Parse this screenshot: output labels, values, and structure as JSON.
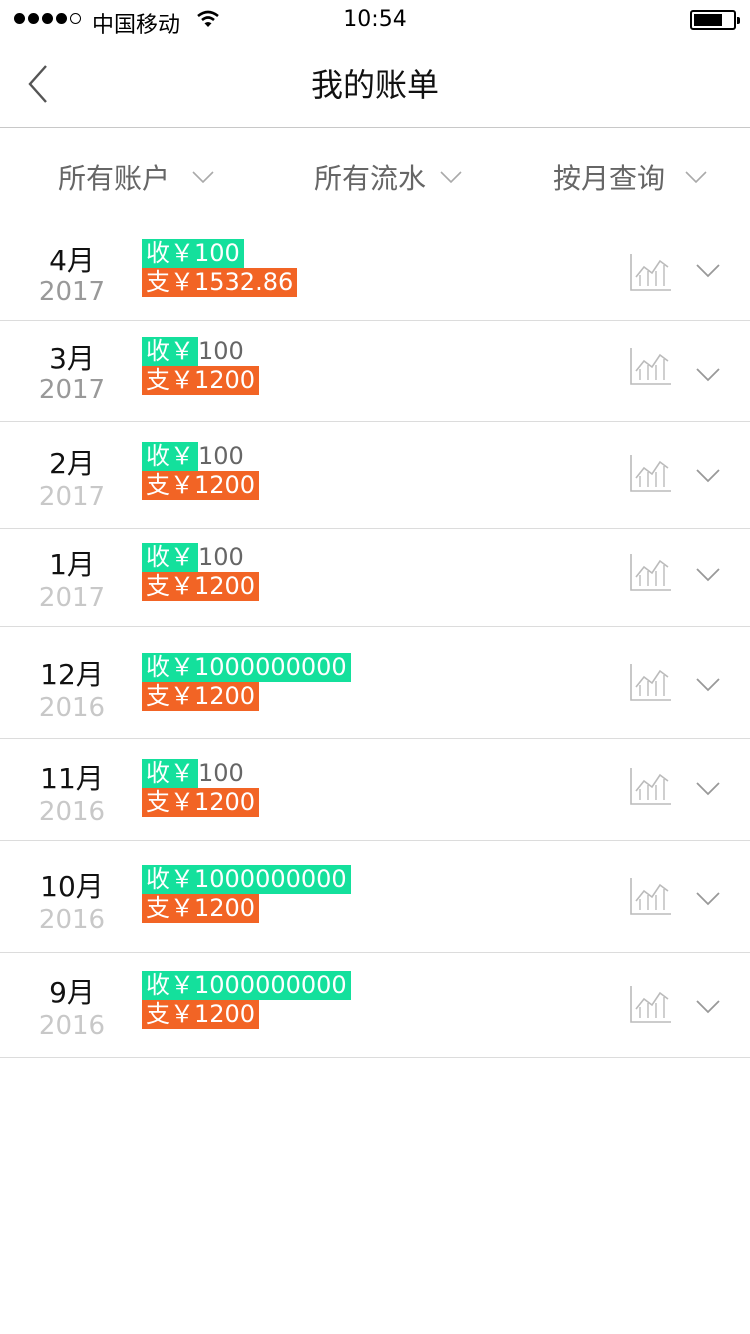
{
  "status": {
    "carrier": "中国移动",
    "time": "10:54"
  },
  "nav": {
    "title": "我的账单"
  },
  "filters": [
    {
      "label": "所有账户"
    },
    {
      "label": "所有流水"
    },
    {
      "label": "按月查询"
    }
  ],
  "rows": [
    {
      "month": "4月",
      "year": "2017",
      "income": "收￥100",
      "income_tail": "",
      "expense": "支￥1532.86",
      "year_color": "#999999"
    },
    {
      "month": "3月",
      "year": "2017",
      "income": "收￥",
      "income_tail": "100",
      "expense": "支￥1200",
      "year_color": "#999999"
    },
    {
      "month": "2月",
      "year": "2017",
      "income": "收￥",
      "income_tail": "100",
      "expense": "支￥1200",
      "year_color": "#c8c8c8"
    },
    {
      "month": "1月",
      "year": "2017",
      "income": "收￥",
      "income_tail": "100",
      "expense": "支￥1200",
      "year_color": "#c8c8c8"
    },
    {
      "month": "12月",
      "year": "2016",
      "income": "收￥1000000000",
      "income_tail": "",
      "expense": "支￥1200",
      "year_color": "#c8c8c8"
    },
    {
      "month": "11月",
      "year": "2016",
      "income": "收￥",
      "income_tail": "100",
      "expense": "支￥1200",
      "year_color": "#c8c8c8"
    },
    {
      "month": "10月",
      "year": "2016",
      "income": "收￥1000000000",
      "income_tail": "",
      "expense": "支￥1200",
      "year_color": "#c8c8c8"
    },
    {
      "month": "9月",
      "year": "2016",
      "income": "收￥1000000000",
      "income_tail": "",
      "expense": "支￥1200",
      "year_color": "#c8c8c8"
    }
  ],
  "icons": {
    "back": "chevron-left-icon",
    "filter_chevron": "chevron-down-icon",
    "row_chart": "line-chart-icon",
    "row_expand": "chevron-down-icon"
  },
  "colors": {
    "income": "#14e09c",
    "expense": "#f26425"
  }
}
